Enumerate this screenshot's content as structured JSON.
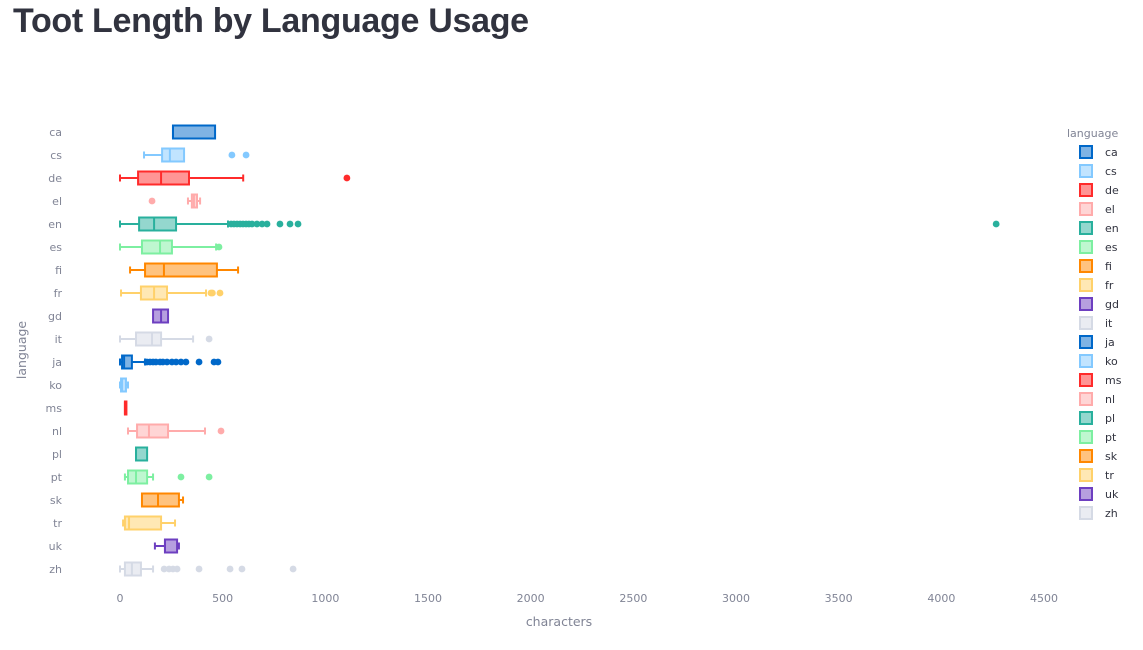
{
  "page": {
    "title": "Toot Length by Language Usage"
  },
  "chart_data": {
    "type": "box",
    "orientation": "horizontal",
    "title": "Toot Length by Language Usage",
    "xlabel": "characters",
    "ylabel": "language",
    "xlim": [
      -30,
      4500
    ],
    "xticks": [
      0,
      500,
      1000,
      1500,
      2000,
      2500,
      3000,
      3500,
      4000,
      4500
    ],
    "xtick_labels": [
      "0",
      "500",
      "1000",
      "1500",
      "2000",
      "2500",
      "3000",
      "3500",
      "4000",
      "4500"
    ],
    "grid": false,
    "legend": {
      "title": "language",
      "position": "right"
    },
    "palette": [
      "#0068c9",
      "#83c9ff",
      "#ff2b2b",
      "#ffabab",
      "#29b09d",
      "#7defa1",
      "#ff8700",
      "#ffd16a",
      "#6d3fc0",
      "#d5dae5"
    ],
    "categories": [
      "ca",
      "cs",
      "de",
      "el",
      "en",
      "es",
      "fi",
      "fr",
      "gd",
      "it",
      "ja",
      "ko",
      "ms",
      "nl",
      "pl",
      "pt",
      "sk",
      "tr",
      "uk",
      "zh"
    ],
    "series": [
      {
        "name": "ca",
        "min": 258,
        "q1": 258,
        "median": 258,
        "q3": 463,
        "max": 463,
        "outliers": []
      },
      {
        "name": "cs",
        "min": 117,
        "q1": 205,
        "median": 243,
        "q3": 312,
        "max": 312,
        "outliers": [
          545,
          614
        ]
      },
      {
        "name": "de",
        "min": 0,
        "q1": 88,
        "median": 200,
        "q3": 336,
        "max": 600,
        "outliers": [
          1105
        ]
      },
      {
        "name": "el",
        "min": 331,
        "q1": 350,
        "median": 360,
        "q3": 375,
        "max": 390,
        "outliers": [
          156
        ]
      },
      {
        "name": "en",
        "min": 0,
        "q1": 93,
        "median": 166,
        "q3": 273,
        "max": 526,
        "outliers": [
          541,
          555,
          570,
          585,
          599,
          614,
          628,
          643,
          667,
          692,
          716,
          779,
          828,
          867,
          4267
        ]
      },
      {
        "name": "es",
        "min": 0,
        "q1": 107,
        "median": 195,
        "q3": 253,
        "max": 468,
        "outliers": [
          482
        ]
      },
      {
        "name": "fi",
        "min": 49,
        "q1": 122,
        "median": 214,
        "q3": 472,
        "max": 575,
        "outliers": []
      },
      {
        "name": "fr",
        "min": 5,
        "q1": 102,
        "median": 166,
        "q3": 229,
        "max": 419,
        "outliers": [
          443,
          450,
          487
        ]
      },
      {
        "name": "gd",
        "min": 161,
        "q1": 161,
        "median": 200,
        "q3": 234,
        "max": 234,
        "outliers": []
      },
      {
        "name": "it",
        "min": 0,
        "q1": 78,
        "median": 156,
        "q3": 200,
        "max": 356,
        "outliers": [
          434
        ]
      },
      {
        "name": "ja",
        "min": 0,
        "q1": 10,
        "median": 20,
        "q3": 58,
        "max": 122,
        "outliers": [
          131,
          146,
          161,
          175,
          195,
          209,
          229,
          253,
          273,
          297,
          321,
          385,
          458,
          477
        ]
      },
      {
        "name": "ko",
        "min": 0,
        "q1": 5,
        "median": 10,
        "q3": 29,
        "max": 39,
        "outliers": []
      },
      {
        "name": "ms",
        "min": 24,
        "q1": 24,
        "median": 24,
        "q3": 24,
        "max": 24,
        "outliers": []
      },
      {
        "name": "nl",
        "min": 39,
        "q1": 83,
        "median": 141,
        "q3": 234,
        "max": 414,
        "outliers": [
          492
        ]
      },
      {
        "name": "pl",
        "min": 78,
        "q1": 78,
        "median": 78,
        "q3": 132,
        "max": 132,
        "outliers": []
      },
      {
        "name": "pt",
        "min": 24,
        "q1": 39,
        "median": 78,
        "q3": 132,
        "max": 161,
        "outliers": [
          297,
          434
        ]
      },
      {
        "name": "sk",
        "min": 107,
        "q1": 107,
        "median": 185,
        "q3": 287,
        "max": 307,
        "outliers": []
      },
      {
        "name": "tr",
        "min": 15,
        "q1": 24,
        "median": 44,
        "q3": 200,
        "max": 268,
        "outliers": []
      },
      {
        "name": "uk",
        "min": 170,
        "q1": 219,
        "median": 219,
        "q3": 278,
        "max": 287,
        "outliers": []
      },
      {
        "name": "zh",
        "min": 0,
        "q1": 24,
        "median": 58,
        "q3": 102,
        "max": 161,
        "outliers": [
          215,
          239,
          258,
          278,
          385,
          536,
          594,
          843
        ]
      }
    ]
  }
}
